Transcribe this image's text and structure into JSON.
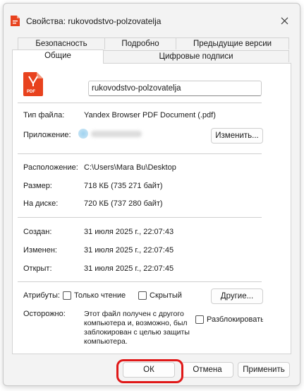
{
  "window": {
    "title": "Свойства: rukovodstvo-polzovatelja"
  },
  "tabs": {
    "row1": [
      "Безопасность",
      "Подробно",
      "Предыдущие версии"
    ],
    "row2": [
      "Общие",
      "Цифровые подписи"
    ]
  },
  "general": {
    "file_name": "rukovodstvo-polzovatelja",
    "file_icon_text": "PDF",
    "file_type_label": "Тип файла:",
    "file_type_value": "Yandex Browser PDF Document (.pdf)",
    "app_label": "Приложение:",
    "change_button": "Изменить...",
    "location_label": "Расположение:",
    "location_value": "C:\\Users\\Mara Bu\\Desktop",
    "size_label": "Размер:",
    "size_value": "718 КБ (735 271 байт)",
    "disk_label": "На диске:",
    "disk_value": "720 КБ (737 280 байт)",
    "created_label": "Создан:",
    "created_value": "31 июля 2025 г., 22:07:43",
    "modified_label": "Изменен:",
    "modified_value": "31 июля 2025 г., 22:07:45",
    "opened_label": "Открыт:",
    "opened_value": "31 июля 2025 г., 22:07:45",
    "attributes_label": "Атрибуты:",
    "readonly_label": "Только чтение",
    "hidden_label": "Скрытый",
    "other_button": "Другие...",
    "warning_label": "Осторожно:",
    "warning_text": [
      "Этот файл получен с другого",
      "компьютера и, возможно, был",
      "заблокирован с целью защиты",
      "компьютера."
    ],
    "unblock_label": "Разблокировать"
  },
  "footer": {
    "ok": "ОК",
    "cancel": "Отмена",
    "apply": "Применить"
  },
  "colors": {
    "pdf_red": "#e8421e",
    "highlight": "#e01818"
  }
}
